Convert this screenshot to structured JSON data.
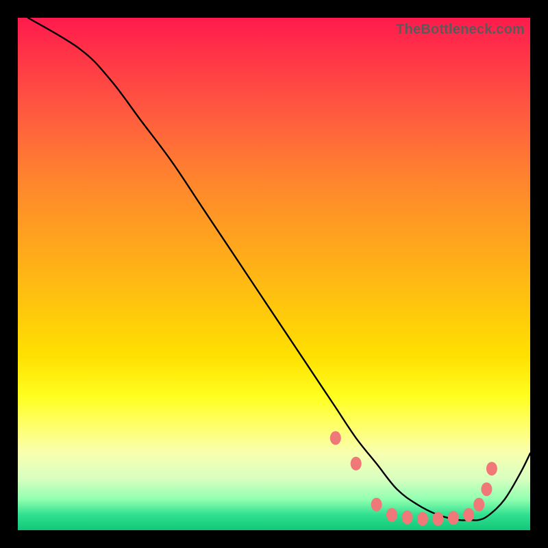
{
  "watermark": "TheBottleneck.com",
  "chart_data": {
    "type": "line",
    "title": "",
    "xlabel": "",
    "ylabel": "",
    "xlim": [
      0,
      100
    ],
    "ylim": [
      0,
      100
    ],
    "series": [
      {
        "name": "curve",
        "x": [
          2,
          12,
          18,
          24,
          30,
          36,
          42,
          48,
          54,
          58,
          62,
          66,
          70,
          74,
          78,
          82,
          86,
          88,
          90,
          92,
          95,
          98,
          100
        ],
        "values": [
          100,
          94,
          88,
          80,
          72,
          63,
          54,
          45,
          36,
          30,
          24,
          18,
          13,
          8,
          5,
          3,
          2,
          2,
          2,
          3,
          6,
          11,
          15
        ]
      }
    ],
    "markers": [
      {
        "x": 62,
        "y": 18
      },
      {
        "x": 66,
        "y": 13
      },
      {
        "x": 70,
        "y": 5
      },
      {
        "x": 73,
        "y": 3
      },
      {
        "x": 76,
        "y": 2.5
      },
      {
        "x": 79,
        "y": 2.2
      },
      {
        "x": 82,
        "y": 2.2
      },
      {
        "x": 85,
        "y": 2.4
      },
      {
        "x": 88,
        "y": 3
      },
      {
        "x": 90,
        "y": 5
      },
      {
        "x": 91.5,
        "y": 8
      },
      {
        "x": 92.5,
        "y": 12
      }
    ],
    "marker_color": "#f07878",
    "curve_color": "#000000"
  }
}
